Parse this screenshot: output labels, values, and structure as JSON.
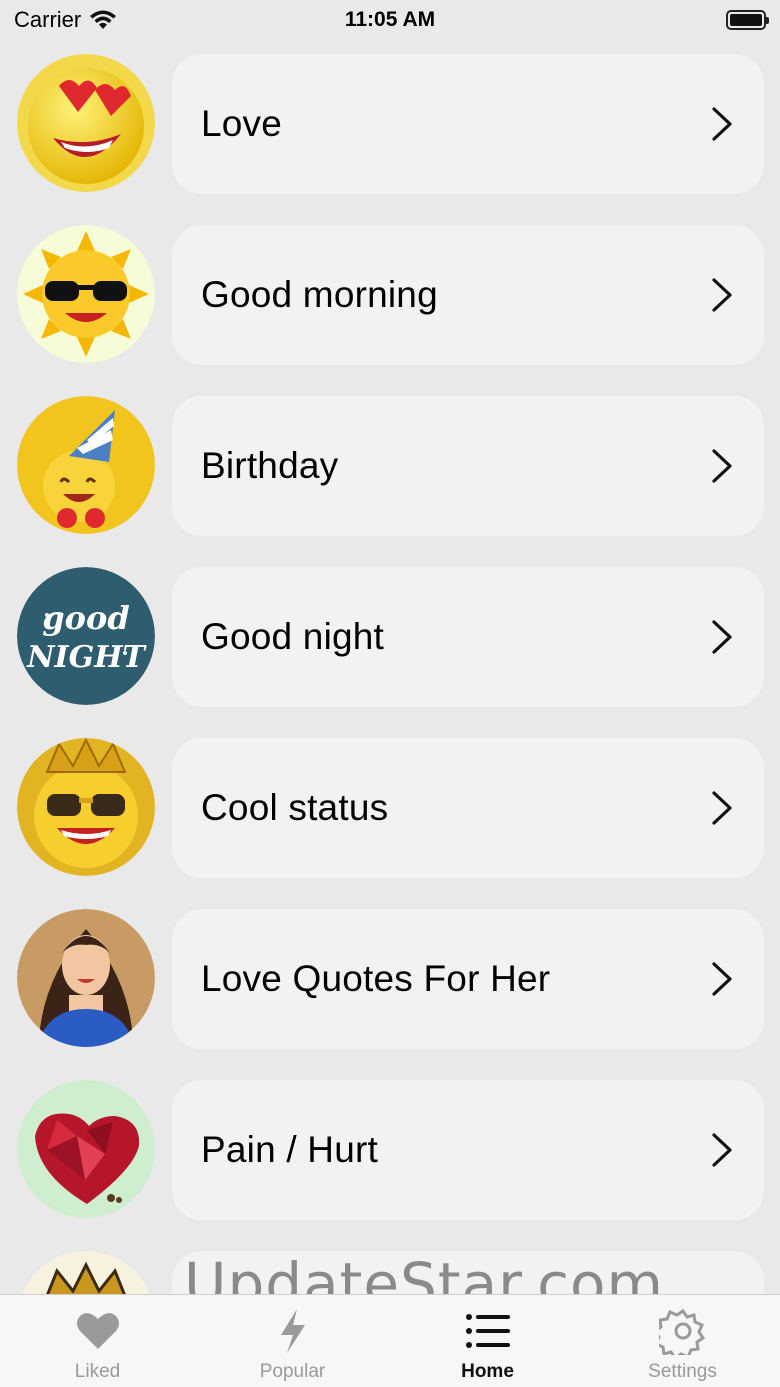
{
  "status_bar": {
    "carrier": "Carrier",
    "time": "11:05 AM"
  },
  "categories": [
    {
      "label": "Love",
      "image": "heart-eyes-emoji"
    },
    {
      "label": "Good morning",
      "image": "sun-sunglasses-emoji"
    },
    {
      "label": "Birthday",
      "image": "party-hat-emoji"
    },
    {
      "label": "Good night",
      "image": "good-night-lettering",
      "image_text": "good NIGHT"
    },
    {
      "label": "Cool status",
      "image": "crown-sunglasses-emoji"
    },
    {
      "label": "Love Quotes For Her",
      "image": "woman-portrait"
    },
    {
      "label": "Pain / Hurt",
      "image": "broken-heart"
    },
    {
      "label": "",
      "image": "crown-emoji-partial"
    }
  ],
  "watermark": "UpdateStar.com",
  "tabs": [
    {
      "label": "Liked",
      "icon": "heart-icon",
      "active": false
    },
    {
      "label": "Popular",
      "icon": "bolt-icon",
      "active": false
    },
    {
      "label": "Home",
      "icon": "list-icon",
      "active": true
    },
    {
      "label": "Settings",
      "icon": "gear-icon",
      "active": false
    }
  ],
  "colors": {
    "background": "#e9e9e9",
    "card": "#f2f2f2",
    "tab_active": "#111111",
    "tab_inactive": "#9a9a9a"
  }
}
